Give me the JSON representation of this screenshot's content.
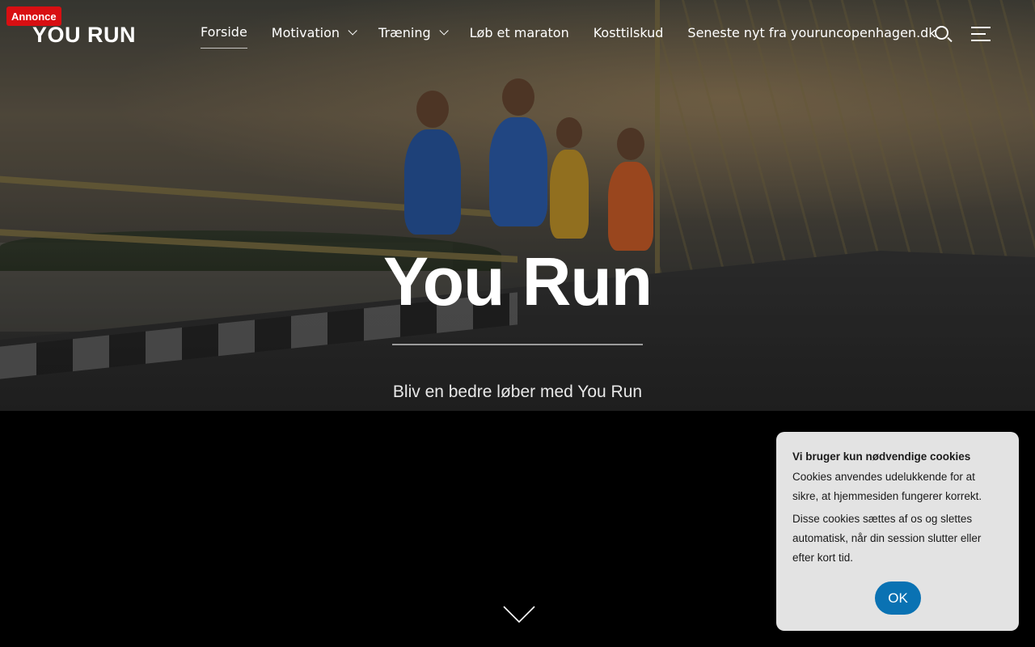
{
  "ad_badge": "Annonce",
  "site": {
    "logo": "YOU RUN"
  },
  "nav": {
    "items": [
      {
        "label": "Forside",
        "active": true,
        "has_dropdown": false
      },
      {
        "label": "Motivation",
        "active": false,
        "has_dropdown": true
      },
      {
        "label": "Træning",
        "active": false,
        "has_dropdown": true
      },
      {
        "label": "Løb et maraton",
        "active": false,
        "has_dropdown": false
      },
      {
        "label": "Kosttilskud",
        "active": false,
        "has_dropdown": false
      },
      {
        "label": "Seneste nyt fra youruncopenhagen.dk",
        "active": false,
        "has_dropdown": false
      }
    ],
    "icons": {
      "search": "search-icon",
      "menu": "hamburger-menu-icon",
      "dropdown": "chevron-down-icon"
    }
  },
  "hero": {
    "title": "You Run",
    "subtitle": "Bliv en bedre løber med You Run",
    "scroll_icon": "chevron-down-icon"
  },
  "cookie_banner": {
    "heading": "Vi bruger kun nødvendige cookies",
    "paragraph_1": "Cookies anvendes udelukkende for at sikre, at hjemmesiden fungerer korrekt.",
    "paragraph_2": "Disse cookies sættes af os og slettes automatisk, når din session slutter eller efter kort tid.",
    "ok_label": "OK"
  },
  "colors": {
    "ad_badge": "#d80f12",
    "cookie_button": "#0a72b3",
    "cookie_bg": "#e3e3e3",
    "page_bg": "#000000"
  }
}
